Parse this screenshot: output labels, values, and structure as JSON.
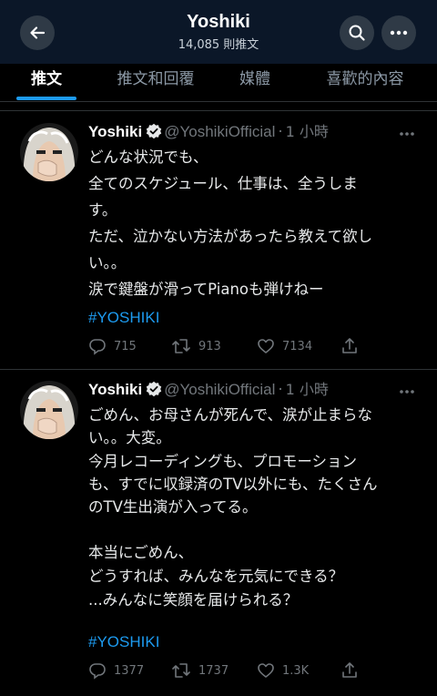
{
  "header": {
    "title": "Yoshiki",
    "tweet_count": "14,085 則推文"
  },
  "tabs": [
    {
      "label": "推文",
      "active": true
    },
    {
      "label": "推文和回覆",
      "active": false
    },
    {
      "label": "媒體",
      "active": false
    },
    {
      "label": "喜歡的內容",
      "active": false
    }
  ],
  "tweets": [
    {
      "name": "Yoshiki",
      "handle": "@YoshikiOfficial",
      "time": "1 小時",
      "lines": [
        "どんな状況でも、",
        "全てのスケジュール、仕事は、全うしま",
        "す。",
        "ただ、泣かない方法があったら教えて欲し",
        "い。。",
        "涙で鍵盤が滑ってPianoも弾けねー"
      ],
      "hashtag": "#YOSHIKI",
      "replies": "715",
      "retweets": "913",
      "likes": "7134"
    },
    {
      "name": "Yoshiki",
      "handle": "@YoshikiOfficial",
      "time": "1 小時",
      "lines": [
        "ごめん、お母さんが死んで、涙が止まらな",
        "い。。大変。",
        "今月レコーディングも、プロモーション",
        "も、すでに収録済のTV以外にも、たくさん",
        "のTV生出演が入ってる。",
        "",
        "本当にごめん、",
        "どうすれば、みんなを元気にできる？",
        "...みんなに笑顔を届けられる？"
      ],
      "hashtag": "#YOSHIKI",
      "replies": "1377",
      "retweets": "1737",
      "likes": "1.3K"
    }
  ],
  "colors": {
    "header_bg": "#0b1728",
    "accent": "#1d9bf0",
    "muted": "#71767b",
    "background": "#000000"
  },
  "icons": [
    "back-arrow-icon",
    "search-icon",
    "more-icon",
    "verified-badge-icon",
    "reply-icon",
    "retweet-icon",
    "like-icon",
    "share-icon",
    "tweet-more-icon"
  ]
}
